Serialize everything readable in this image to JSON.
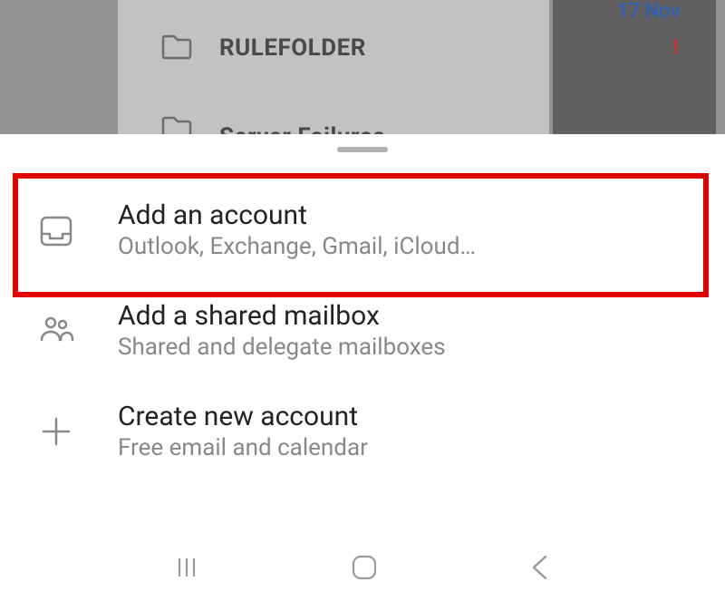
{
  "background": {
    "folder1": "RULEFOLDER",
    "folder2": "Server Failures",
    "date": "17 Nov"
  },
  "sheet": {
    "options": [
      {
        "title": "Add an account",
        "subtitle": "Outlook, Exchange, Gmail, iCloud…"
      },
      {
        "title": "Add a shared mailbox",
        "subtitle": "Shared and delegate mailboxes"
      },
      {
        "title": "Create new account",
        "subtitle": "Free email and calendar"
      }
    ]
  }
}
